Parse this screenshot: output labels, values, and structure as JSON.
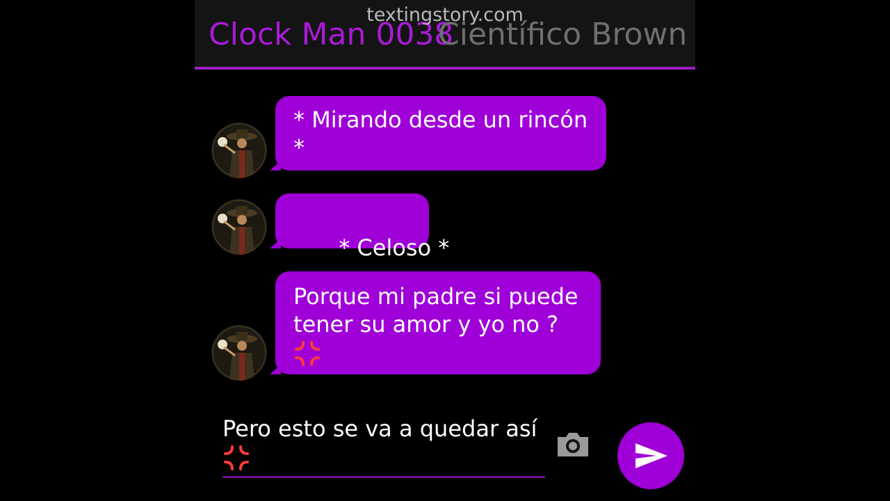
{
  "watermark": "textingstory.com",
  "header": {
    "contact_name": "Clock Man 0038",
    "other_name": "Científico Brown"
  },
  "messages": [
    {
      "text": "* Mirando desde un rincón *"
    },
    {
      "text": " * Celoso *"
    },
    {
      "text": "Porque mi padre si puede tener su amor y yo no ?",
      "emoji": "anger-symbol-icon"
    }
  ],
  "composer": {
    "value": "Pero esto se va a quedar así",
    "emoji": "anger-symbol-icon"
  },
  "colors": {
    "accent": "#a000d8",
    "header_bg": "#141414",
    "contact_name": "#a81bd6"
  }
}
